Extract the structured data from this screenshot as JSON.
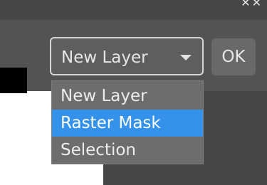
{
  "titlebar": {
    "controls_icon": "window-controls-icon"
  },
  "dialog": {
    "color_swatch": "#000000"
  },
  "dropdown": {
    "selected_value": "New Layer",
    "arrow_icon": "caret-down-icon",
    "options": [
      {
        "label": "New Layer",
        "selected": false
      },
      {
        "label": "Raster Mask",
        "selected": true
      },
      {
        "label": "Selection",
        "selected": false
      }
    ]
  },
  "ok_button": {
    "label": "OK"
  },
  "colors": {
    "background": "#535353",
    "highlight": "#3592eb",
    "menu_background": "#6d6d6d"
  }
}
